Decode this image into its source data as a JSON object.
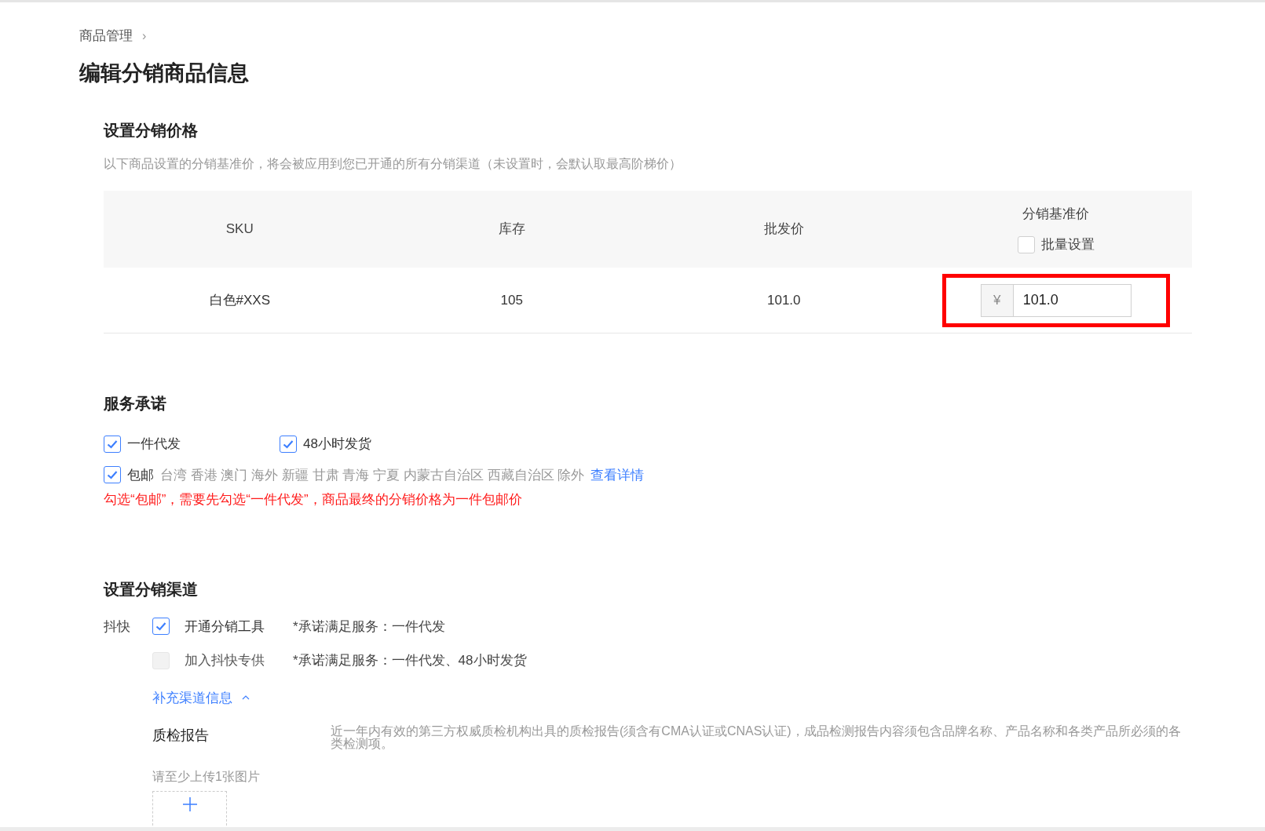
{
  "breadcrumb": {
    "label": "商品管理",
    "separator": "›"
  },
  "title": "编辑分销商品信息",
  "price_section": {
    "heading": "设置分销价格",
    "description": "以下商品设置的分销基准价，将会被应用到您已开通的所有分销渠道（未设置时，会默认取最高阶梯价）",
    "table": {
      "columns": [
        "SKU",
        "库存",
        "批发价",
        "分销基准价"
      ],
      "bulk_setting": {
        "label": "批量设置",
        "checked": false
      },
      "rows": [
        {
          "sku": "白色#XXS",
          "stock": "105",
          "wholesale": "101.0",
          "currency": "¥",
          "price": "101.0",
          "highlighted": true
        }
      ]
    }
  },
  "service_section": {
    "heading": "服务承诺",
    "options": [
      {
        "label": "一件代发",
        "checked": true
      },
      {
        "label": "48小时发货",
        "checked": true
      },
      {
        "label": "包邮",
        "checked": true,
        "exclusions": "台湾 香港 澳门 海外 新疆 甘肃 青海 宁夏 内蒙古自治区 西藏自治区 除外",
        "link": "查看详情"
      }
    ],
    "warning": "勾选“包邮”，需要先勾选“一件代发”，商品最终的分销价格为一件包邮价"
  },
  "channel_section": {
    "heading": "设置分销渠道",
    "channel": "抖快",
    "options": [
      {
        "label": "开通分销工具",
        "checked": true,
        "disabled": false,
        "note": "*承诺满足服务：一件代发"
      },
      {
        "label": "加入抖快专供",
        "checked": false,
        "disabled": true,
        "note": "*承诺满足服务：一件代发、48小时发货"
      }
    ],
    "more": {
      "label": "补充渠道信息",
      "expanded": true
    },
    "quality_report": {
      "label": "质检报告",
      "description": "近一年内有效的第三方权威质检机构出具的质检报告(须含有CMA认证或CNAS认证)，成品检测报告内容须包含品牌名称、产品名称和各类产品所必须的各类检测项。",
      "hint": "请至少上传1张图片"
    }
  }
}
